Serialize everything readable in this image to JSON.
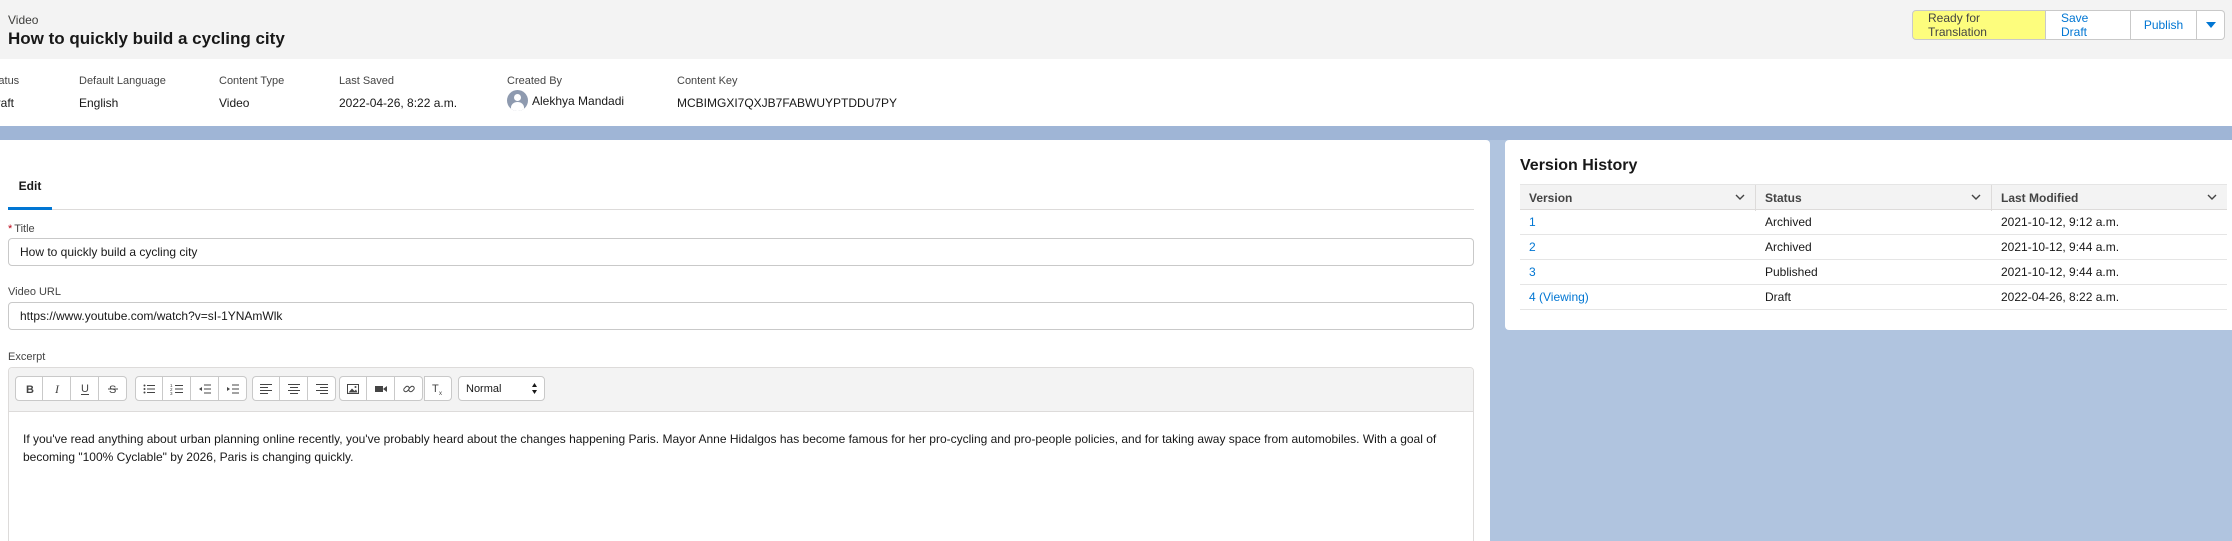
{
  "header": {
    "object_label": "Video",
    "title": "How to quickly build a cycling city",
    "buttons": {
      "ready": "Ready for Translation",
      "save_draft": "Save Draft",
      "publish": "Publish"
    },
    "accent_color": "#0176d3",
    "highlight_color": "#fdfd7d"
  },
  "highlights": {
    "status": {
      "label": "Status",
      "value": "Draft"
    },
    "default_language": {
      "label": "Default Language",
      "value": "English"
    },
    "content_type": {
      "label": "Content Type",
      "value": "Video"
    },
    "last_saved": {
      "label": "Last Saved",
      "value": "2022-04-26, 8:22 a.m."
    },
    "created_by": {
      "label": "Created By",
      "value": "Alekhya Mandadi"
    },
    "content_key": {
      "label": "Content Key",
      "value": "MCBIMGXI7QXJB7FABWUYPTDDU7PY"
    }
  },
  "edit": {
    "tab_label": "Edit",
    "title_label": "Title",
    "title_value": "How to quickly build a cycling city",
    "video_url_label": "Video URL",
    "video_url_value": "https://www.youtube.com/watch?v=sI-1YNAmWlk",
    "excerpt_label": "Excerpt",
    "format_select": "Normal",
    "excerpt_text": "If you've read anything about urban planning online recently, you've probably heard about the changes happening Paris. Mayor Anne Hidalgos has become famous for her pro-cycling and pro-people policies, and for taking away space from automobiles. With a goal of becoming \"100% Cyclable\" by 2026, Paris is changing quickly."
  },
  "toolbar_icons": [
    "bold-icon",
    "italic-icon",
    "underline-icon",
    "strikethrough-icon",
    "bullet-list-icon",
    "numbered-list-icon",
    "outdent-icon",
    "indent-icon",
    "align-left-icon",
    "align-center-icon",
    "align-right-icon",
    "image-icon",
    "video-icon",
    "link-icon",
    "clear-format-icon"
  ],
  "version_history": {
    "title": "Version History",
    "columns": [
      "Version",
      "Status",
      "Last Modified"
    ],
    "rows": [
      {
        "version": "1",
        "status": "Archived",
        "modified": "2021-10-12, 9:12 a.m."
      },
      {
        "version": "2",
        "status": "Archived",
        "modified": "2021-10-12, 9:44 a.m."
      },
      {
        "version": "3",
        "status": "Published",
        "modified": "2021-10-12, 9:44 a.m."
      },
      {
        "version": "4 (Viewing)",
        "status": "Draft",
        "modified": "2022-04-26, 8:22 a.m."
      }
    ]
  }
}
